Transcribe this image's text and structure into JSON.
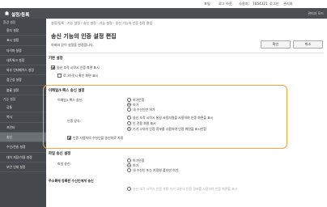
{
  "topbar": {
    "portal": "포털",
    "logout": "로그 아웃",
    "user_label": "사용자:",
    "user_id": "7654321",
    "login_label": "로그인",
    "admin_name": "관리자"
  },
  "appbar": {
    "title": "설정/등록",
    "admin_mode": "관리자 모드"
  },
  "sidebar": {
    "sections": [
      {
        "title": "환경 설정",
        "items": [
          "용지 설정",
          "표시 설정",
          "타이머 설정",
          "네트워크 설정",
          "외부 인터페이스 설정",
          "접근성 설정",
          "볼륨 설정"
        ]
      },
      {
        "title": "기능 설정",
        "items": [
          "공통",
          "복사",
          "프린터",
          "송신",
          "수신/전송 설정",
          "데이 저장/이용 설정",
          "보안 인쇄 설정"
        ]
      }
    ],
    "active_item": "송신"
  },
  "main": {
    "breadcrumb": "설정/등록 : 기능 설정 : 송신 설정 : 기능 설정 : 송신 기능의 인증 설정 편집",
    "title": "송신 기능의 인증 설정 편집",
    "subtitle": "아래와 같이 설정을 변경합니다.",
    "ok_label": "확인",
    "cancel_label": "취소",
    "basic": {
      "heading": "기본 설정",
      "show_auth_on_send": "송신 조작 시작시 인증 화면 표시",
      "show_logout_confirm": "로그아웃시 확인 화면 표시"
    },
    "email_ifax": {
      "heading": "이메일/I-팩스 송신 설정",
      "auth_label": "이메일/I-팩스 송신:",
      "auth_options": [
        "허가안함",
        "허가",
        "내 수신인만 허가"
      ],
      "method_label": "인증 방식:",
      "method_options": [
        "송신 조작 시작시 통일 사용자명을 사용하여 인증 화면을 표시",
        "인 전용 화면 표시",
        "기기 고유의 인증 정보를 사용하여 인증 화면을 표시안함"
      ],
      "allow_change_sender": "인증 사용자의 수신인을 송신처로 지정"
    },
    "file": {
      "heading": "파일 송신 설정",
      "send_label": "파일 송신:",
      "send_options": [
        "허가안함",
        "허가",
        "내 수신인 또는 지정한 폴더만 허가"
      ]
    },
    "address_book": {
      "heading": "주소록에 등록된 수신인에게 송신",
      "option": "송신 조작 시작시 인증 사용 기기 고유의 인증 정보를 사용하여 인증 화면을 표시"
    }
  }
}
